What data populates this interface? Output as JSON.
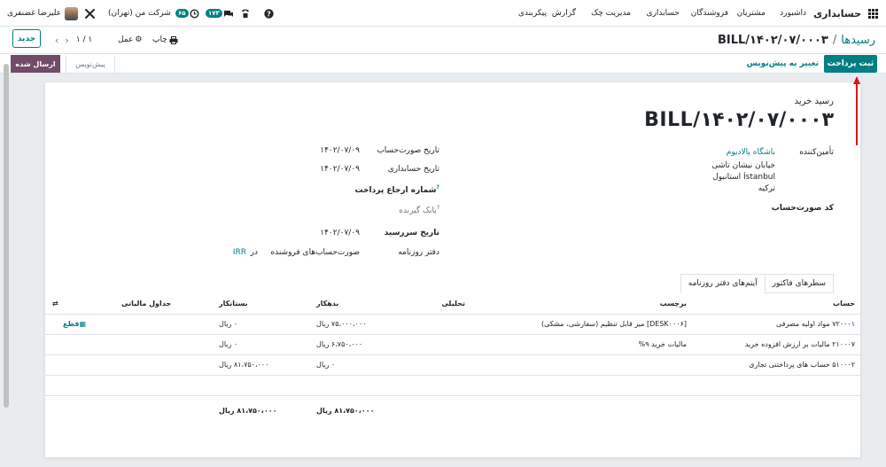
{
  "navbar": {
    "app_title": "حسابداری",
    "menu": [
      "داشبورد",
      "مشتریان",
      "فروشندگان",
      "حسابداری",
      "مدیریت چک",
      "گزارش",
      "پیکربندی"
    ],
    "user_name": "علیرضا غضنفری",
    "company": "شرکت من (تهران)",
    "activity_count": "۶۵",
    "messages_count": "۱۷۳"
  },
  "control": {
    "new_button": "جدید",
    "pager": "۱ / ۱",
    "action_label": "عمل",
    "print_label": "چاپ",
    "breadcrumb_parent": "رسیدها",
    "breadcrumb_sep": "/",
    "breadcrumb_current": "BILL/۱۴۰۲/۰۷/۰۰۰۳"
  },
  "status": {
    "post_button": "ثبت پرداخت",
    "reset_draft_button": "تغییر به پیش‌نویس",
    "stages": [
      "ارسال شده",
      "پیش‌نویس"
    ],
    "active_stage": "ارسال شده"
  },
  "form": {
    "doc_type": "رسید خرید",
    "doc_name": "BILL/۱۴۰۲/۰۷/۰۰۰۳",
    "vendor_label": "تأمین‌کننده",
    "vendor_name": "باشگاه پالادیوم",
    "vendor_address": [
      "خیابان نیشان تاشی",
      "استانبول İstanbul",
      "ترکیه"
    ],
    "bill_ref_label": "کد صورت‌حساب",
    "invoice_date_label": "تاریخ صورت‌حساب",
    "invoice_date": "۱۴۰۲/۰۷/۰۹",
    "accounting_date_label": "تاریخ حسابداری",
    "accounting_date": "۱۴۰۲/۰۷/۰۹",
    "payment_ref_label": "شماره ارجاع پرداخت",
    "help_mark": "?",
    "bank_label": "بانک گیرنده",
    "due_date_label": "تاریخ سررسید",
    "due_date": "۱۴۰۲/۰۷/۰۹",
    "journal_label": "دفتر روزنامه",
    "journal": "صورت‌حساب‌های فروشنده",
    "in_label": "در",
    "currency": "IRR"
  },
  "tabs": [
    "سطرهای فاکتور",
    "آیتم‌های دفتر روزنامه"
  ],
  "active_tab": "آیتم‌های دفتر روزنامه",
  "table": {
    "headers": [
      "حساب",
      "برچسب",
      "تحلیلی",
      "بدهکار",
      "بستانکار",
      "جداول مالیاتی"
    ],
    "rows": [
      {
        "account": "۷۲۰۰۰۱ مواد اولیه مصرفی",
        "label": "[DESK۰۰۰۶] میز قابل تنظیم (سفارشی، مشکی)",
        "analytic": "",
        "debit": "۷۵،۰۰۰،۰۰۰ ریال",
        "credit": "۰ ریال",
        "tax": "قطع"
      },
      {
        "account": "۲۱۰۰۰۷ مالیات بر ارزش افزوده خرید",
        "label": "مالیات خرید ۹%",
        "analytic": "",
        "debit": "۶،۷۵۰،۰۰۰ ریال",
        "credit": "۰ ریال",
        "tax": ""
      },
      {
        "account": "۵۱۰۰۰۲ حساب های پرداختنی تجاری",
        "label": "",
        "analytic": "",
        "debit": "۰ ریال",
        "credit": "۸۱،۷۵۰،۰۰۰ ریال",
        "tax": ""
      }
    ],
    "total_debit": "۸۱،۷۵۰،۰۰۰ ریال",
    "total_credit": "۸۱،۷۵۰،۰۰۰ ریال"
  },
  "colors": {
    "brand": "#017e84",
    "stage_active": "#714b67",
    "annotation": "#e0101a"
  }
}
